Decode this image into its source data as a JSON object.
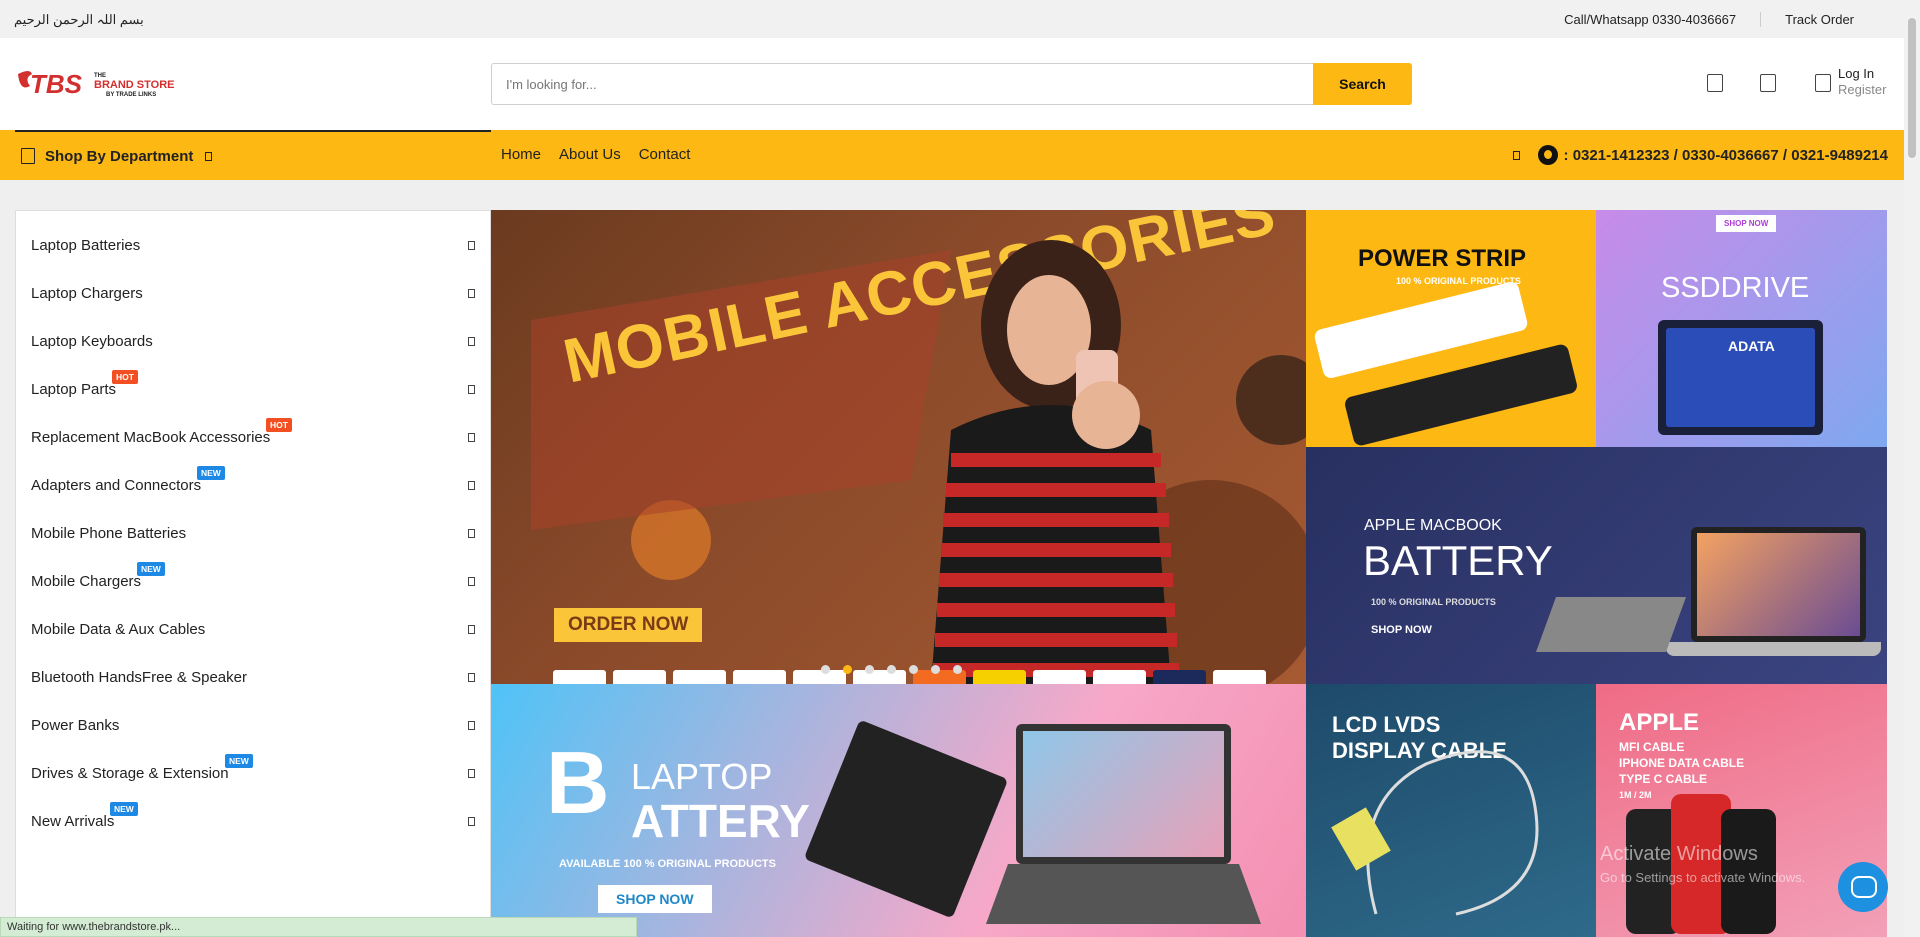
{
  "topbar": {
    "bismillah": "بسم اللہ الرحمن الرحیم",
    "call": "Call/Whatsapp 0330-4036667",
    "track": "Track Order"
  },
  "header": {
    "logo_text": "TBS",
    "logo_sub": "THE BRAND STORE",
    "logo_sub2": "BY TRADE LINKS",
    "search_placeholder": "I'm looking for...",
    "search_button": "Search",
    "login": "Log In",
    "register": "Register"
  },
  "nav": {
    "dept": "Shop By Department",
    "menu": [
      "Home",
      "About Us",
      "Contact"
    ],
    "phones": ": 0321-1412323 / 0330-4036667 / 0321-9489214"
  },
  "sidebar": {
    "items": [
      {
        "label": "Laptop Batteries",
        "badge": ""
      },
      {
        "label": "Laptop Chargers",
        "badge": ""
      },
      {
        "label": "Laptop Keyboards",
        "badge": ""
      },
      {
        "label": "Laptop Parts",
        "badge": "HOT"
      },
      {
        "label": "Replacement MacBook Accessories",
        "badge": "HOT"
      },
      {
        "label": "Adapters and Connectors",
        "badge": "NEW"
      },
      {
        "label": "Mobile Phone Batteries",
        "badge": ""
      },
      {
        "label": "Mobile Chargers",
        "badge": "NEW"
      },
      {
        "label": "Mobile Data & Aux Cables",
        "badge": ""
      },
      {
        "label": "Bluetooth HandsFree & Speaker",
        "badge": ""
      },
      {
        "label": "Power Banks",
        "badge": ""
      },
      {
        "label": "Drives & Storage & Extension",
        "badge": "NEW"
      },
      {
        "label": "New Arrivals",
        "badge": "NEW"
      }
    ]
  },
  "banners": {
    "main_title": "MOBILE ACCESSORIES",
    "main_cta": "ORDER NOW",
    "power_title": "POWER STRIP",
    "power_sub": "100 % ORIGINAL PRODUCTS",
    "ssd_title": "SSDDRIVE",
    "ssd_now": "SHOP NOW",
    "ssd_brand": "ADATA",
    "mac_sub": "APPLE MACBOOK",
    "mac_title": "BATTERY",
    "mac_sub2": "100 % ORIGINAL PRODUCTS",
    "mac_shop": "SHOP NOW",
    "lap_b": "B",
    "lap_title1": "LAPTOP",
    "lap_title2": "ATTERY",
    "lap_sub": "AVAILABLE 100 % ORIGINAL PRODUCTS",
    "lap_shop": "SHOP NOW",
    "lcd_title": "LCD LVDS DISPLAY CABLE",
    "apple_title": "APPLE",
    "apple_sub1": "MFI CABLE",
    "apple_sub2": "IPHONE DATA CABLE",
    "apple_sub3": "TYPE C CABLE",
    "apple_sub4": "1M / 2M"
  },
  "overlay": {
    "activate": "Activate Windows",
    "activate_sub": "Go to Settings to activate Windows."
  },
  "status": "Waiting for www.thebrandstore.pk...",
  "colors": {
    "accent": "#fdb813",
    "hot": "#f25022",
    "new": "#1e88e5"
  }
}
